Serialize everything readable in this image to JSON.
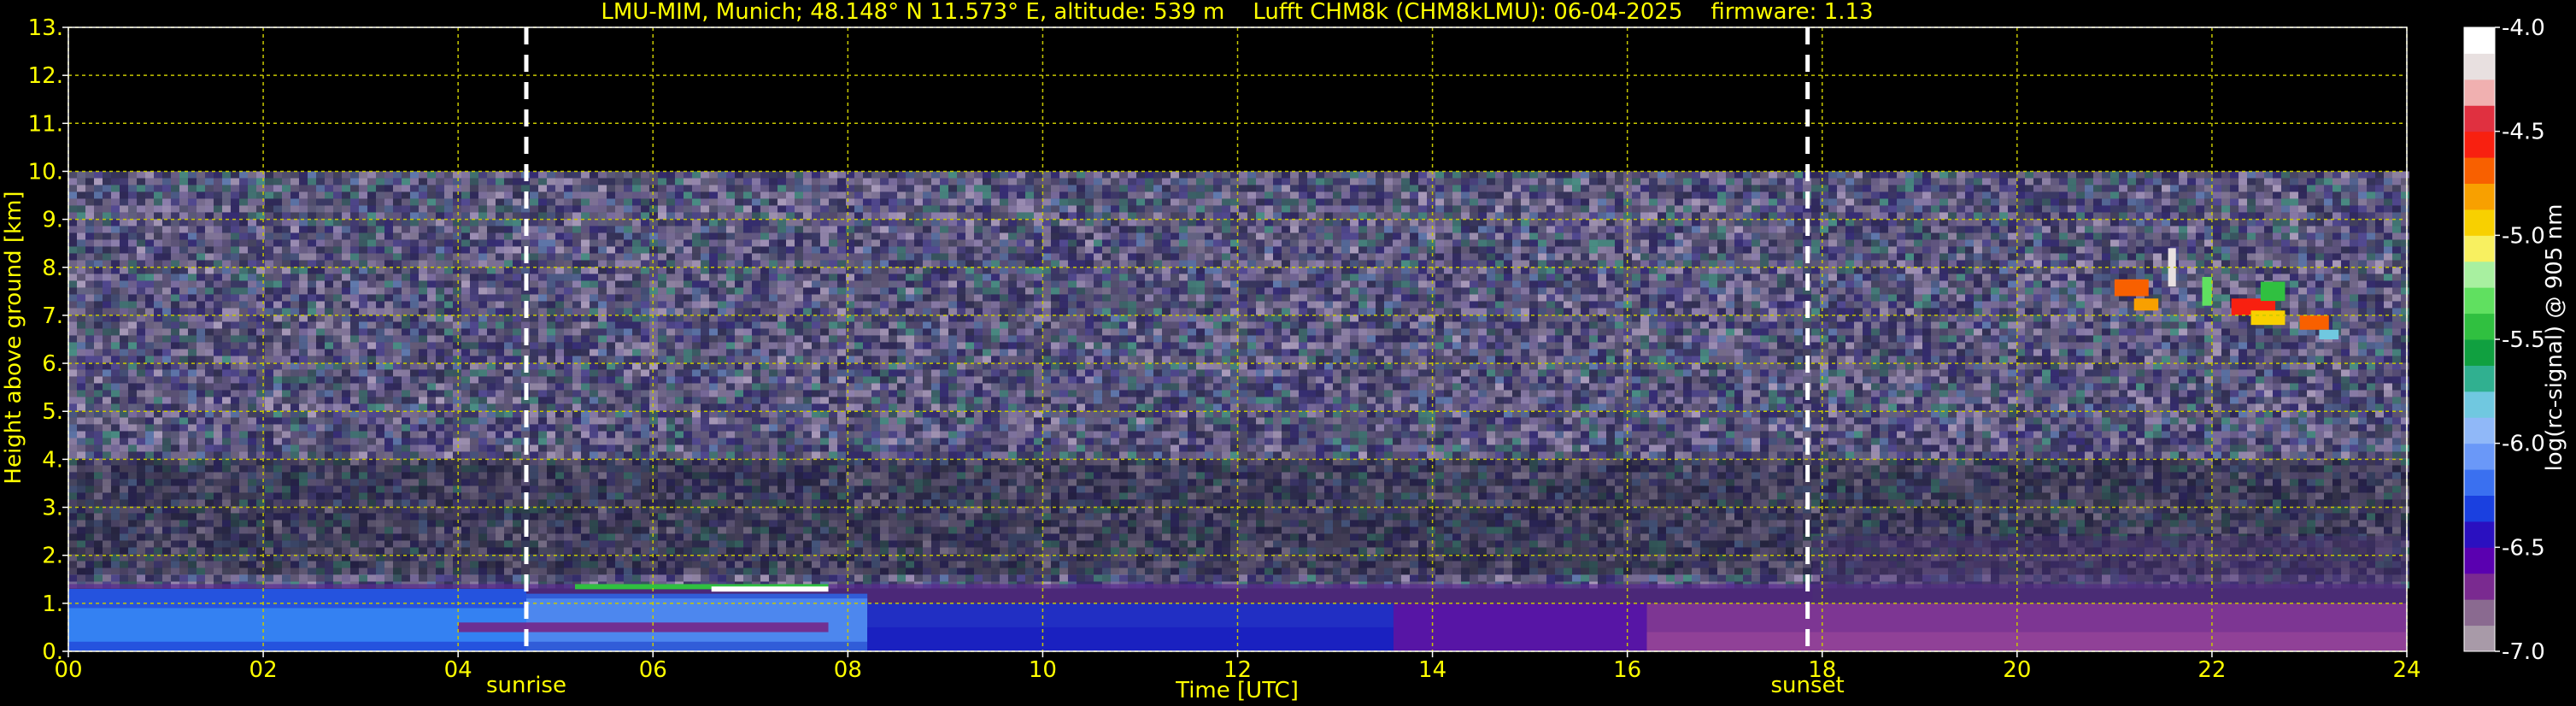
{
  "chart_data": {
    "type": "heatmap",
    "title": "LMU-MIM, Munich; 48.148° N 11.573° E, altitude: 539 m    Lufft CHM8k (CHM8kLMU): 06-04-2025    firmware: 1.13",
    "xlabel": "Time [UTC]",
    "ylabel": "Height above ground [km]",
    "xlim": [
      0,
      24
    ],
    "ylim": [
      0,
      13
    ],
    "x_ticks": [
      0,
      2,
      4,
      6,
      8,
      10,
      12,
      14,
      16,
      18,
      20,
      22,
      24
    ],
    "x_tick_labels": [
      "00",
      "02",
      "04",
      "06",
      "08",
      "10",
      "12",
      "14",
      "16",
      "18",
      "20",
      "22",
      "24"
    ],
    "y_ticks": [
      0,
      1,
      2,
      3,
      4,
      5,
      6,
      7,
      8,
      9,
      10,
      11,
      12,
      13
    ],
    "y_tick_labels": [
      "0.",
      "1.",
      "2.",
      "3.",
      "4.",
      "5.",
      "6.",
      "7.",
      "8.",
      "9.",
      "10.",
      "11.",
      "12.",
      "13."
    ],
    "grid": true,
    "data_top_km": 10,
    "vertical_markers": [
      {
        "label": "sunrise",
        "x": 4.7
      },
      {
        "label": "sunset",
        "x": 17.85
      }
    ],
    "colorbar": {
      "label": "log(rc-signal) @ 905 nm",
      "range": [
        -7.0,
        -4.0
      ],
      "ticks": [
        -7.0,
        -6.5,
        -6.0,
        -5.5,
        -5.0,
        -4.5,
        -4.0
      ],
      "tick_labels": [
        "-7.0",
        "-6.5",
        "-6.0",
        "-5.5",
        "-5.0",
        "-4.5",
        "-4.0"
      ],
      "colors": [
        "#a89aa8",
        "#8a6a90",
        "#7a2a90",
        "#5a00b0",
        "#2a10c0",
        "#1a40e0",
        "#3a70f0",
        "#6a98f8",
        "#90b8f8",
        "#70c8e0",
        "#30b090",
        "#10a040",
        "#30c040",
        "#60e060",
        "#a8f0a0",
        "#f8f060",
        "#f8d000",
        "#f8a000",
        "#f86000",
        "#f82010",
        "#e03040",
        "#f0b0b0",
        "#e8e0e0",
        "#ffffff"
      ]
    },
    "features": [
      {
        "name": "boundary layer",
        "x": [
          0,
          24
        ],
        "y": [
          0,
          1.4
        ],
        "level": -6.5
      },
      {
        "name": "noise field",
        "x": [
          0,
          24
        ],
        "y": [
          0,
          10
        ],
        "level": -6.8
      },
      {
        "name": "cloud layer",
        "x": [
          21.0,
          23.3
        ],
        "y": [
          6.3,
          8.0
        ],
        "level": -5.5
      },
      {
        "name": "low cloud",
        "x": [
          5.2,
          7.8
        ],
        "y": [
          1.2,
          1.4
        ],
        "level": -4.2
      }
    ]
  },
  "colors": {
    "axis_text": "#ffff00",
    "grid": "#c8c800",
    "cbar_text": "#ffffff",
    "marker": "#ffffff"
  }
}
